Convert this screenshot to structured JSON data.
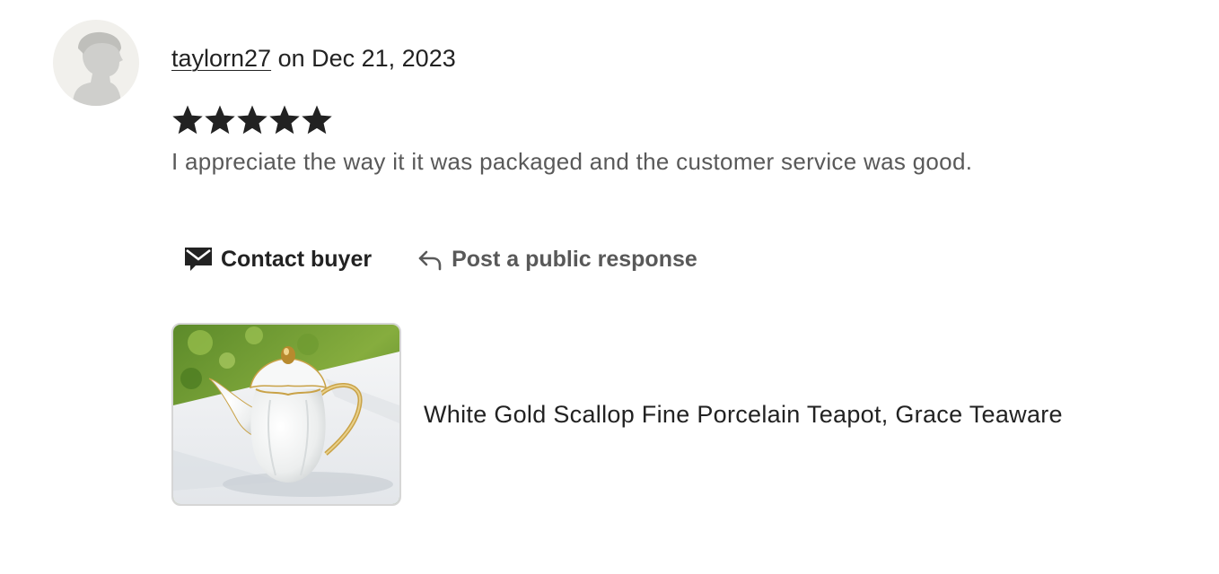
{
  "review": {
    "username": "taylorn27",
    "date_text": " on Dec 21, 2023",
    "rating": 5,
    "rating_max": 5,
    "text": "I appreciate the way it it was packaged and the customer service was good."
  },
  "actions": {
    "contact_label": "Contact buyer",
    "contact_icon": "envelope-icon",
    "respond_label": "Post a public response",
    "respond_icon": "reply-arrow-icon"
  },
  "product": {
    "title": "White Gold Scallop Fine Porcelain Teapot, Grace Teaware",
    "image_icon": "teapot-photo"
  },
  "colors": {
    "text_primary": "#222222",
    "text_secondary": "#595959",
    "avatar_bg": "#f1f0ec",
    "avatar_figure": "#cfcfcc",
    "star": "#222222",
    "thumb_border": "#d6d6d6"
  }
}
